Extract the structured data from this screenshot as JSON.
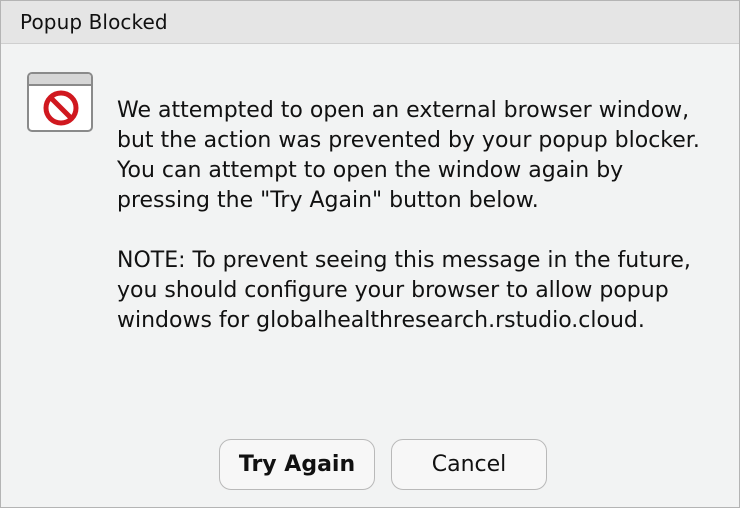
{
  "dialog": {
    "title": "Popup Blocked",
    "icon": "blocked-popup-icon",
    "message": {
      "paragraph1": "We attempted to open an external browser window, but the action was prevented by your popup blocker. You can attempt to open the window again by pressing the \"Try Again\" button below.",
      "paragraph2": "NOTE: To prevent seeing this message in the future, you should configure your browser to allow popup windows for globalhealthresearch.rstudio.cloud."
    },
    "buttons": {
      "try_again": "Try Again",
      "cancel": "Cancel"
    }
  },
  "colors": {
    "stop_red": "#d0181f",
    "background": "#f2f3f3",
    "titlebar": "#e5e5e5"
  }
}
